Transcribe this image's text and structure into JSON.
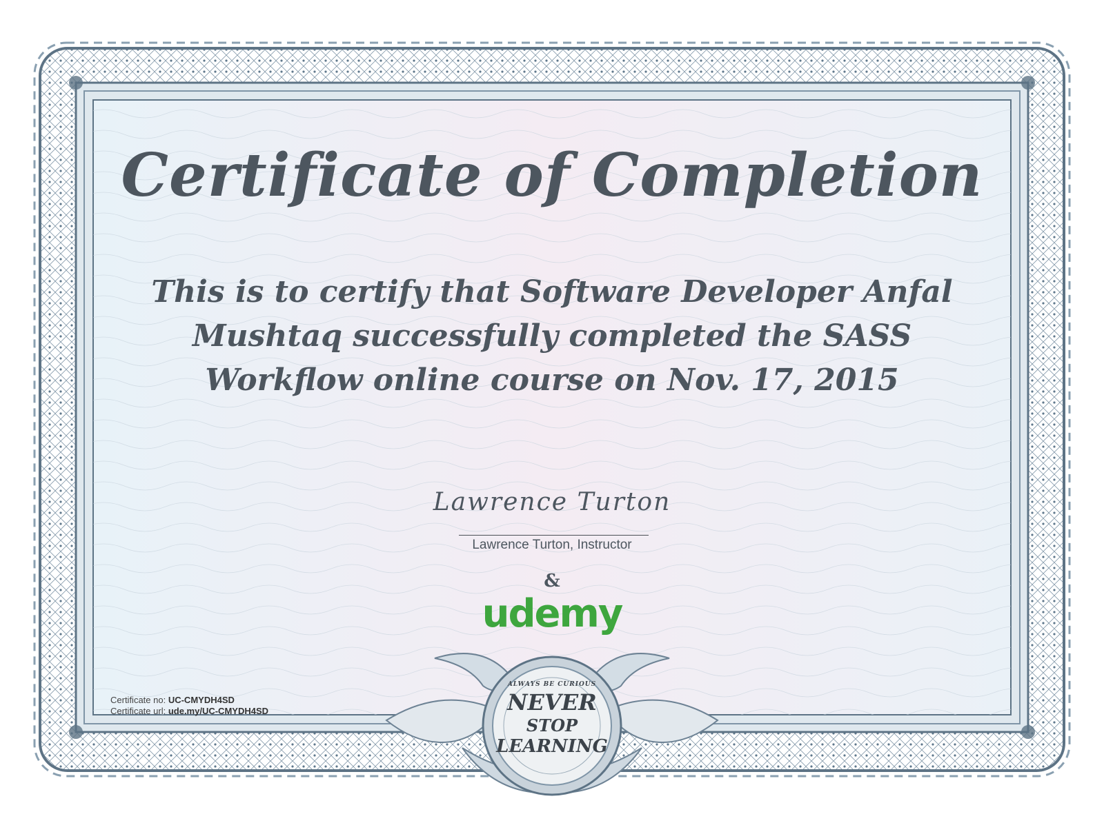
{
  "certificate": {
    "title": "Certificate of Completion",
    "statement": "This is to certify that Software Developer Anfal Mushtaq successfully completed the SASS Workflow online course on Nov. 17, 2015",
    "signature": "Lawrence Turton",
    "signer_caption": "Lawrence Turton, Instructor",
    "ampersand": "&",
    "logo": "udemy",
    "cert_no_label": "Certificate no:",
    "cert_no": "UC-CMYDH4SD",
    "cert_url_label": "Certificate url:",
    "cert_url": "ude.my/UC-CMYDH4SD"
  },
  "seal": {
    "line1": "ALWAYS BE CURIOUS",
    "line2": "NEVER",
    "line3": "STOP",
    "line4": "LEARNING"
  },
  "colors": {
    "text": "#4d565f",
    "border": "#5d7385",
    "logo_green": "#3ea63e",
    "background": "#eef3f8"
  }
}
